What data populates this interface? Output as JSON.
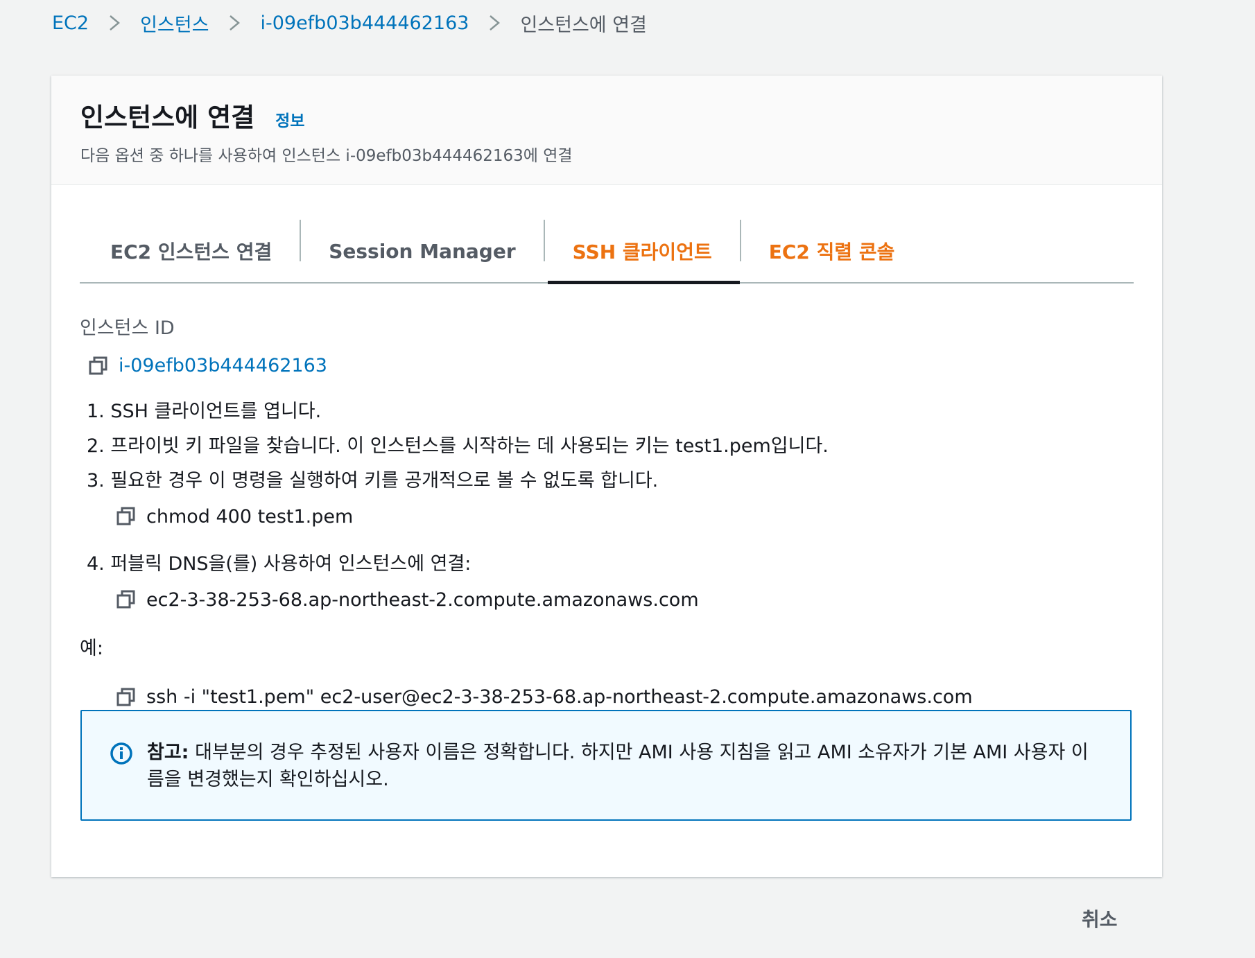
{
  "breadcrumb": {
    "items": [
      {
        "label": "EC2"
      },
      {
        "label": "인스턴스"
      },
      {
        "label": "i-09efb03b444462163"
      }
    ],
    "current": "인스턴스에 연결"
  },
  "header": {
    "title": "인스턴스에 연결",
    "info_link": "정보",
    "subtitle": "다음 옵션 중 하나를 사용하여 인스턴스 i-09efb03b444462163에 연결"
  },
  "tabs": [
    {
      "label": "EC2 인스턴스 연결"
    },
    {
      "label": "Session Manager"
    },
    {
      "label": "SSH 클라이언트",
      "active": true
    },
    {
      "label": "EC2 직렬 콘솔"
    }
  ],
  "content": {
    "instance_id_label": "인스턴스 ID",
    "instance_id_value": "i-09efb03b444462163",
    "steps": [
      "1. SSH 클라이언트를 엽니다.",
      "2. 프라이빗 키 파일을 찾습니다. 이 인스턴스를 시작하는 데 사용되는 키는 test1.pem입니다.",
      "3. 필요한 경우 이 명령을 실행하여 키를 공개적으로 볼 수 없도록 합니다.",
      "4. 퍼블릭 DNS을(를) 사용하여 인스턴스에 연결:"
    ],
    "chmod_command": "chmod 400 test1.pem",
    "public_dns": "ec2-3-38-253-68.ap-northeast-2.compute.amazonaws.com",
    "example_label": "예:",
    "ssh_command": "ssh -i \"test1.pem\" ec2-user@ec2-3-38-253-68.ap-northeast-2.compute.amazonaws.com"
  },
  "alert": {
    "prefix": "참고:",
    "text": " 대부분의 경우 추정된 사용자 이름은 정확합니다. 하지만 AMI 사용 지침을 읽고 AMI 소유자가 기본 AMI 사용자 이름을 변경했는지 확인하십시오.",
    "icon": "info-icon"
  },
  "footer": {
    "cancel_label": "취소"
  },
  "colors": {
    "link": "#0073bb",
    "accent": "#ec7211",
    "alert_bg": "#f1faff",
    "alert_border": "#0073bb"
  }
}
